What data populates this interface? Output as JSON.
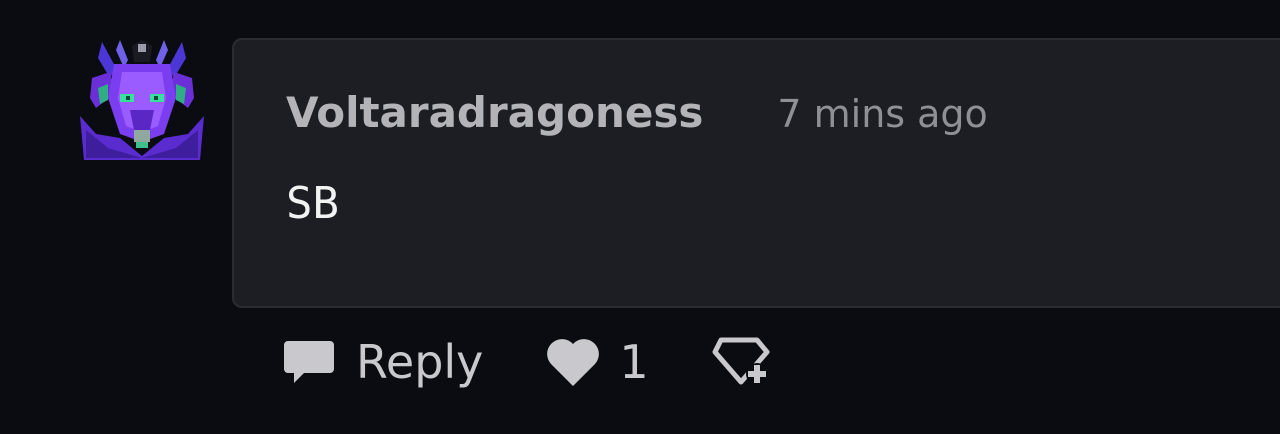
{
  "comment": {
    "username": "Voltaradragoness",
    "timestamp": "7 mins ago",
    "body": "SB"
  },
  "actions": {
    "reply_label": "Reply",
    "like_count": "1"
  },
  "icons": {
    "avatar": "dragon-avatar-icon",
    "reply": "speech-bubble-icon",
    "like": "heart-icon",
    "collect": "gem-plus-icon"
  },
  "colors": {
    "background": "#0b0c11",
    "bubble": "#1c1e24",
    "username": "#b4b4b8",
    "timestamp": "#8f9096",
    "body": "#f2f2f2",
    "actions": "#c9c9cd"
  }
}
